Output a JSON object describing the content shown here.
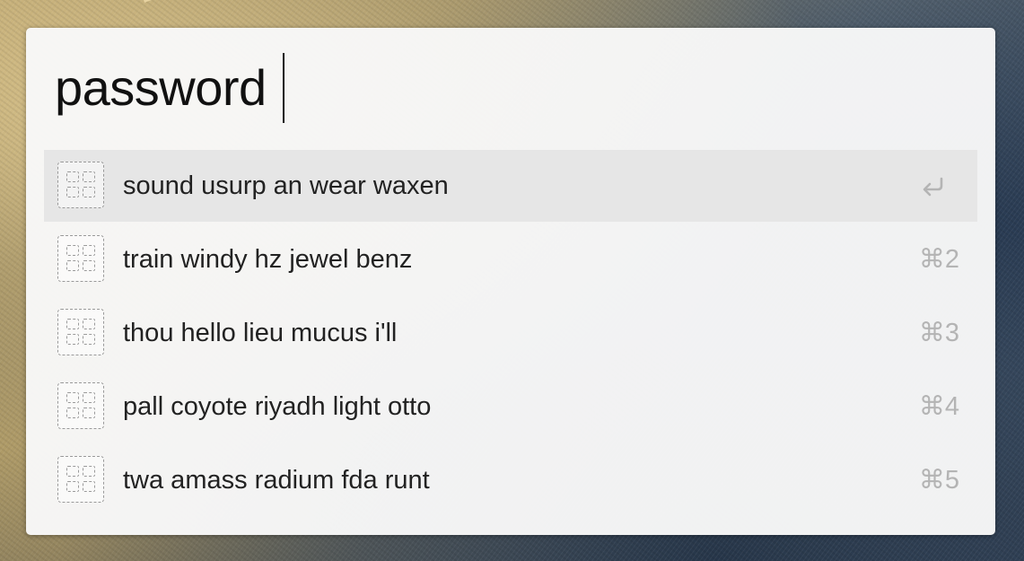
{
  "search": {
    "query": "password"
  },
  "results": [
    {
      "title": "sound usurp an wear waxen",
      "shortcut": "",
      "icon": "enter-icon",
      "selected": true
    },
    {
      "title": "train windy hz jewel benz",
      "shortcut": "⌘2",
      "selected": false
    },
    {
      "title": "thou hello lieu mucus i'll",
      "shortcut": "⌘3",
      "selected": false
    },
    {
      "title": "pall coyote riyadh light otto",
      "shortcut": "⌘4",
      "selected": false
    },
    {
      "title": "twa amass radium fda runt",
      "shortcut": "⌘5",
      "selected": false
    }
  ],
  "colors": {
    "panel_background": "#f8f8f8",
    "selected_row": "#e6e6e6",
    "shortcut_text": "#b4b4b4",
    "primary_text": "#222222"
  }
}
